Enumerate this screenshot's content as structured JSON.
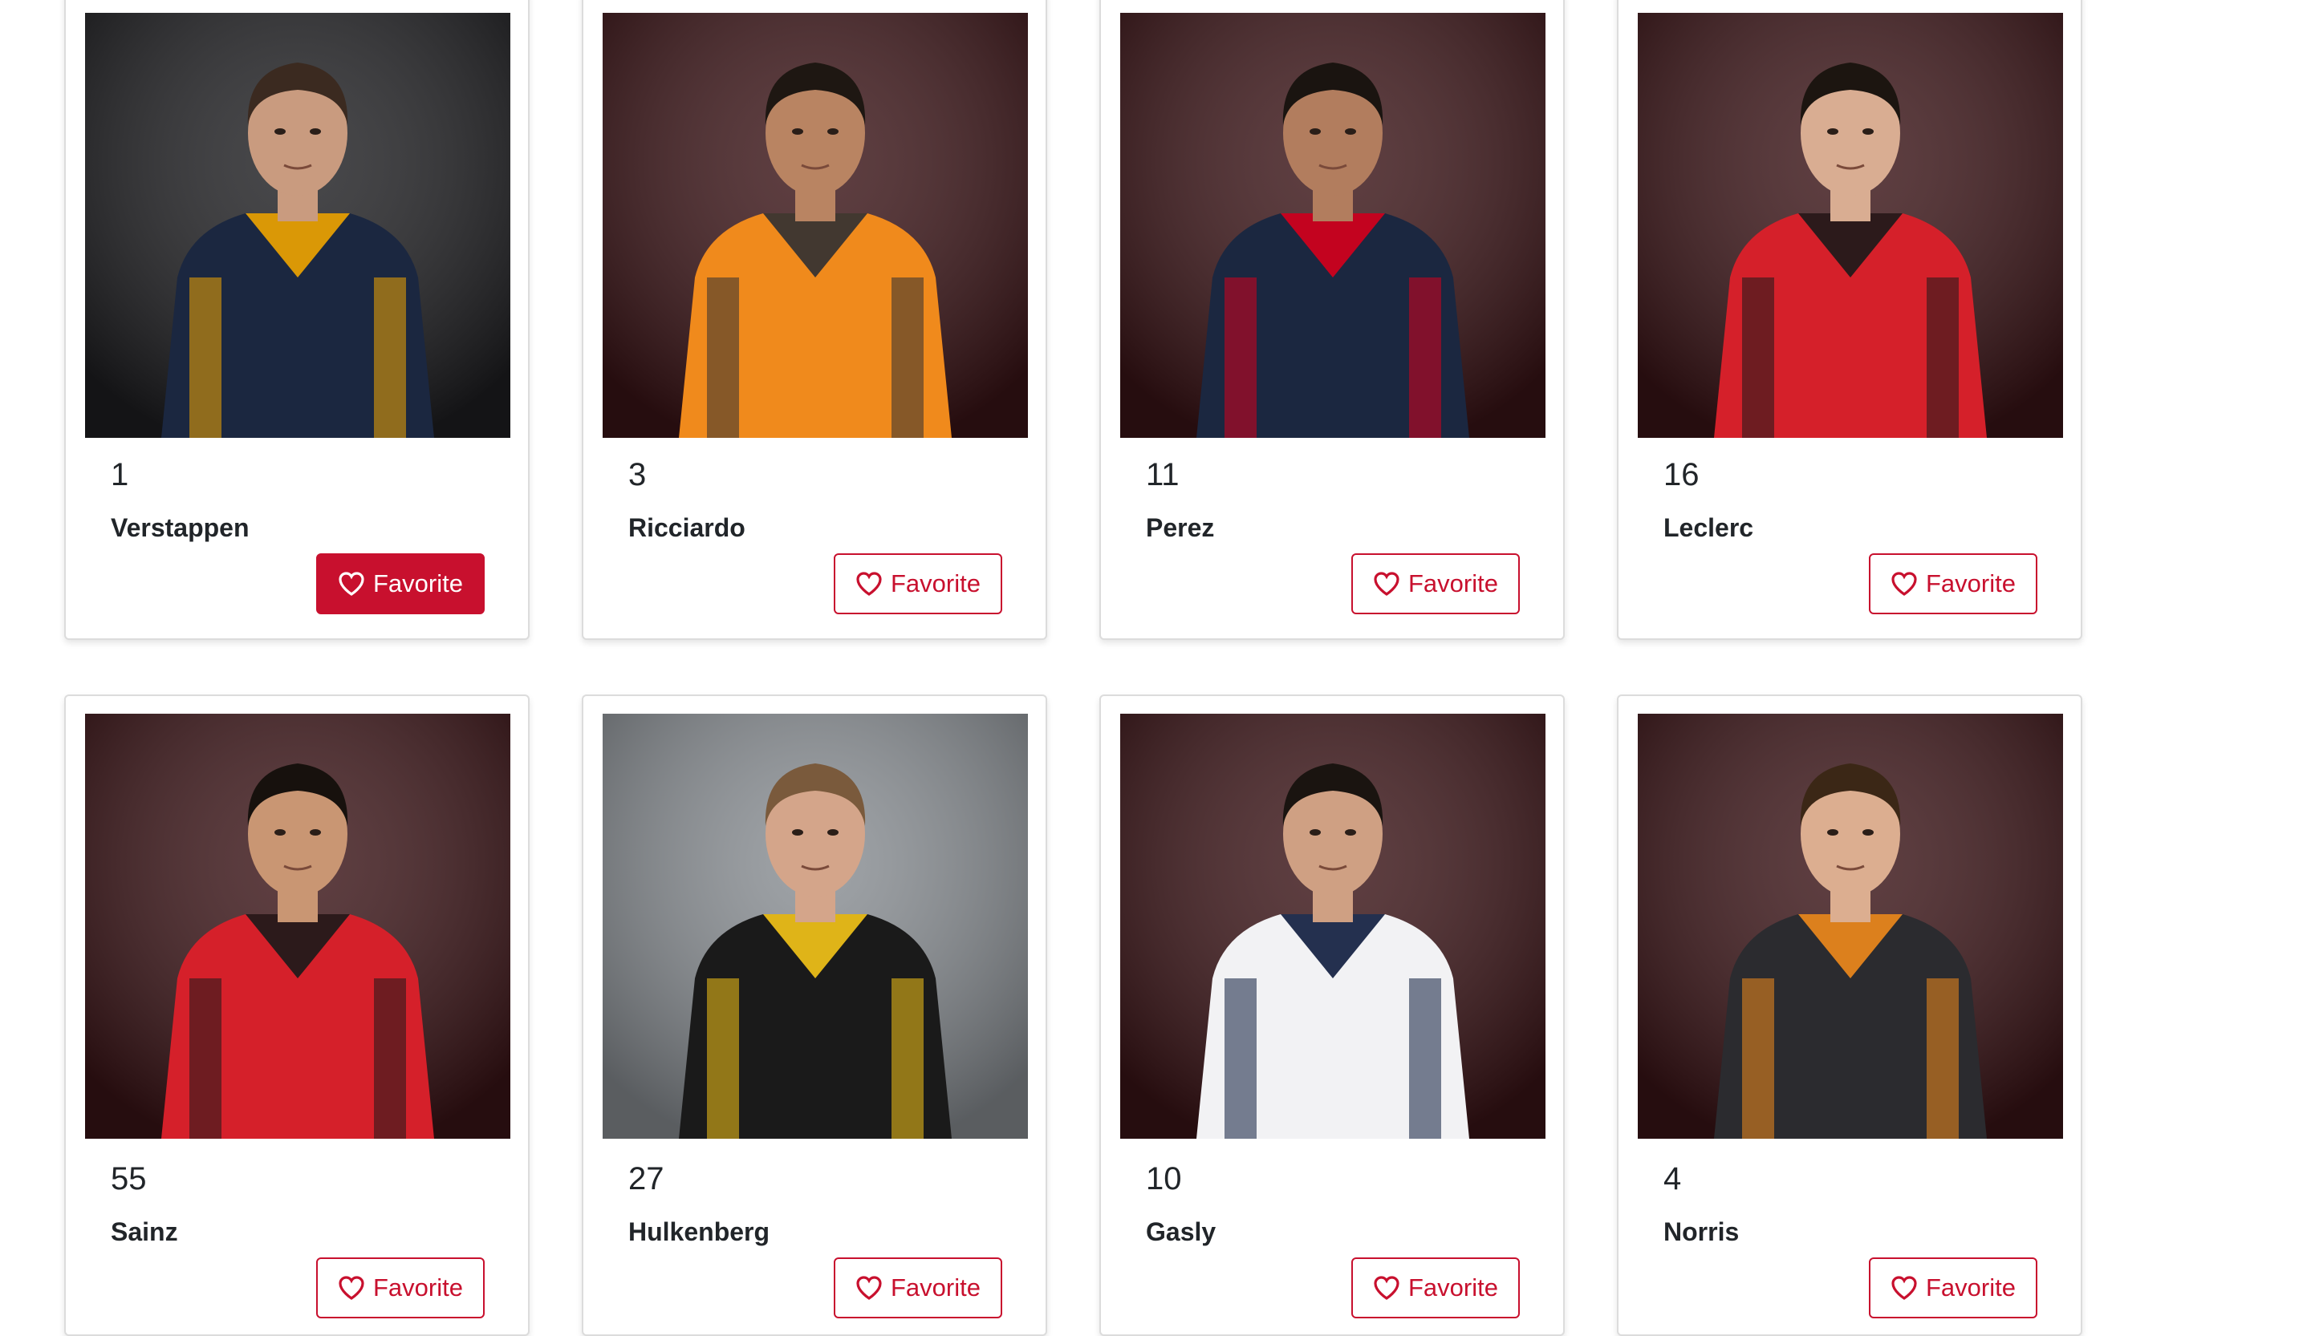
{
  "drivers": [
    {
      "number": "1",
      "name": "Verstappen",
      "favorite_label": "Favorite",
      "favorited": true,
      "suit": "#1b2740",
      "accent": "#f0a500",
      "bg": "#1f1f22",
      "skin": "#c99b7f",
      "hair": "#3b2a20"
    },
    {
      "number": "3",
      "name": "Ricciardo",
      "favorite_label": "Favorite",
      "favorited": false,
      "suit": "#f08a1c",
      "accent": "#2f2f33",
      "bg": "#3b1417",
      "skin": "#b98462",
      "hair": "#1e1712"
    },
    {
      "number": "11",
      "name": "Perez",
      "favorite_label": "Favorite",
      "favorited": false,
      "suit": "#1b2740",
      "accent": "#d6001c",
      "bg": "#3b1417",
      "skin": "#b27d5e",
      "hair": "#1a1410"
    },
    {
      "number": "16",
      "name": "Leclerc",
      "favorite_label": "Favorite",
      "favorited": false,
      "suit": "#d5202a",
      "accent": "#1a1a1a",
      "bg": "#3b1417",
      "skin": "#d9ad92",
      "hair": "#1c1510"
    },
    {
      "number": "55",
      "name": "Sainz",
      "favorite_label": "Favorite",
      "favorited": false,
      "suit": "#d5202a",
      "accent": "#1a1a1a",
      "bg": "#3b1417",
      "skin": "#c99673",
      "hair": "#17110d"
    },
    {
      "number": "27",
      "name": "Hulkenberg",
      "favorite_label": "Favorite",
      "favorited": false,
      "suit": "#1a1a1a",
      "accent": "#f5c518",
      "bg": "#8a8f94",
      "skin": "#d4a58a",
      "hair": "#7a5a3c"
    },
    {
      "number": "10",
      "name": "Gasly",
      "favorite_label": "Favorite",
      "favorited": false,
      "suit": "#f2f2f4",
      "accent": "#0d1b3d",
      "bg": "#3b1417",
      "skin": "#cfa083",
      "hair": "#1a1410"
    },
    {
      "number": "4",
      "name": "Norris",
      "favorite_label": "Favorite",
      "favorited": false,
      "suit": "#2b2b2f",
      "accent": "#f08a1c",
      "bg": "#3b1417",
      "skin": "#dcae90",
      "hair": "#3b2716"
    }
  ],
  "colors": {
    "brand_red": "#c8102e"
  },
  "icons": {
    "favorite": "heart-icon"
  }
}
